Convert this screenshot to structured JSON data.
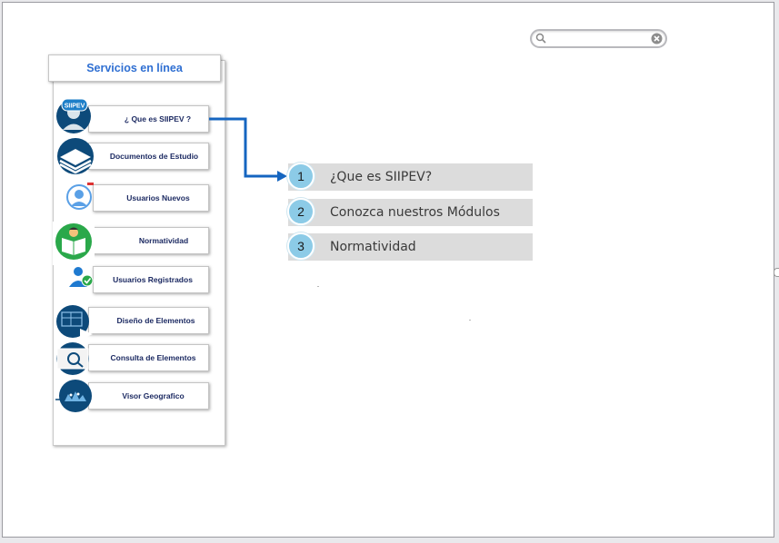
{
  "search": {
    "value": "",
    "placeholder": ""
  },
  "panel": {
    "title": "Servicios en línea",
    "items": [
      {
        "label": "¿ Que es SIIPEV ?",
        "icon": "siipev-icon",
        "icon_text": "SIIPEV"
      },
      {
        "label": "Documentos de Estudio",
        "icon": "documents-stack-icon"
      },
      {
        "label": "Usuarios Nuevos",
        "icon": "new-user-icon"
      },
      {
        "label": "Normatividad",
        "icon": "reading-person-icon"
      },
      {
        "label": "Usuarios Registrados",
        "icon": "registered-user-icon"
      },
      {
        "label": "Diseño de Elementos",
        "icon": "design-elements-icon"
      },
      {
        "label": "Consulta de Elementos",
        "icon": "consult-elements-icon"
      },
      {
        "label": "Visor Geografico",
        "icon": "geographic-viewer-icon"
      }
    ]
  },
  "steps": [
    {
      "number": "1",
      "label": "¿Que es SIIPEV?"
    },
    {
      "number": "2",
      "label": "Conozca nuestros Módulos"
    },
    {
      "number": "3",
      "label": "Normatividad"
    }
  ],
  "colors": {
    "title_blue": "#2f6fd2",
    "menu_text": "#1c2a62",
    "connector": "#1565c0",
    "step_bg": "#dcdcdc",
    "step_circle": "#8ccbe7",
    "icon_dark_blue": "#0d4a7a",
    "icon_green": "#2aa84a"
  }
}
